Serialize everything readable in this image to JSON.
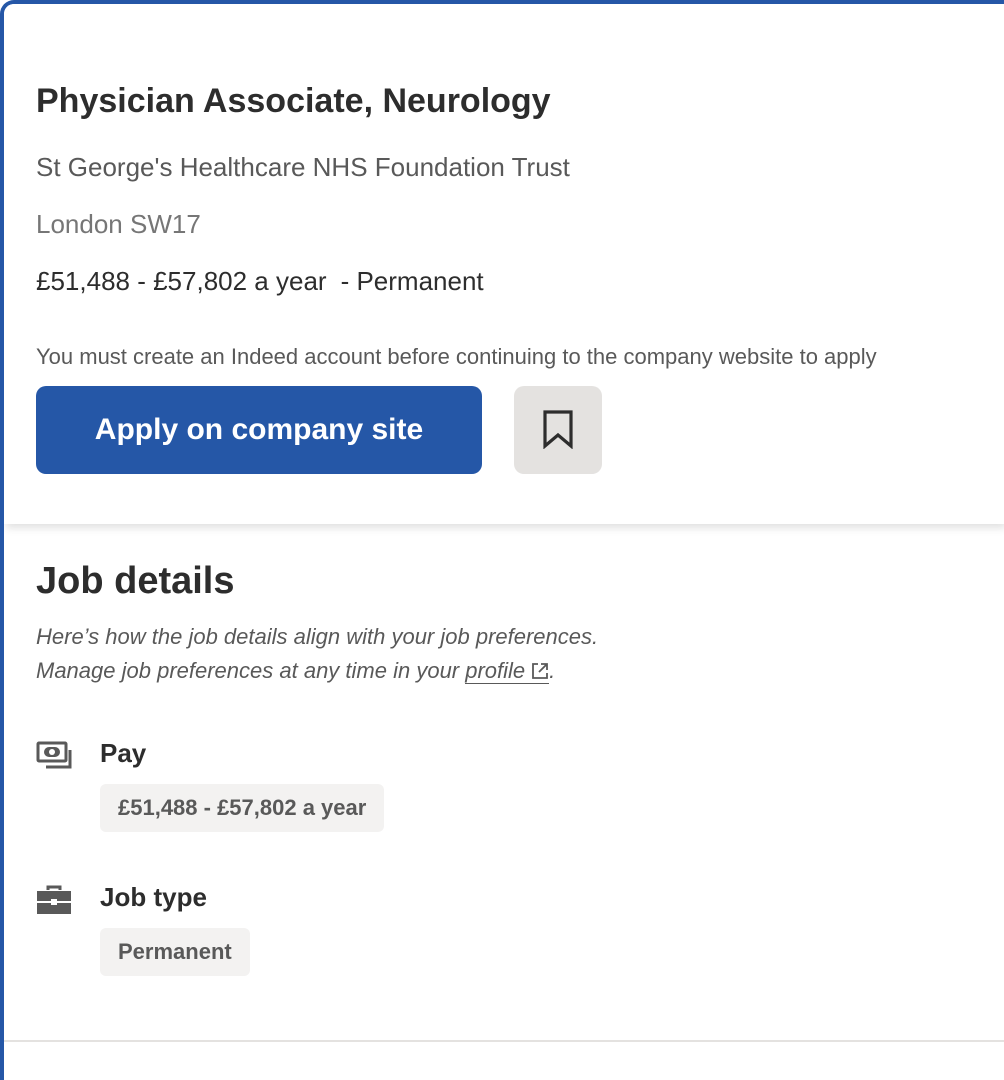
{
  "job": {
    "title": "Physician Associate, Neurology",
    "company": "St George's Healthcare NHS Foundation Trust",
    "location": "London SW17",
    "salary": "£51,488 - £57,802 a year",
    "employment_suffix": "- Permanent",
    "account_note": "You must create an Indeed account before continuing to the company website to apply",
    "apply_label": "Apply on company site",
    "save_icon": "bookmark-icon"
  },
  "details": {
    "title": "Job details",
    "pref_line1": "Here’s how the job details align with your job preferences.",
    "pref_line2_prefix": "Manage job preferences at any time in your ",
    "pref_link": "profile",
    "pref_line2_suffix": ".",
    "pay": {
      "label": "Pay",
      "icon": "money-icon",
      "value": "£51,488 - £57,802 a year"
    },
    "job_type": {
      "label": "Job type",
      "icon": "briefcase-icon",
      "value": "Permanent"
    }
  },
  "colors": {
    "accent": "#2557a7",
    "text": "#2d2d2d",
    "muted": "#595959",
    "chip_bg": "#f3f2f1",
    "save_bg": "#e4e2e0"
  }
}
